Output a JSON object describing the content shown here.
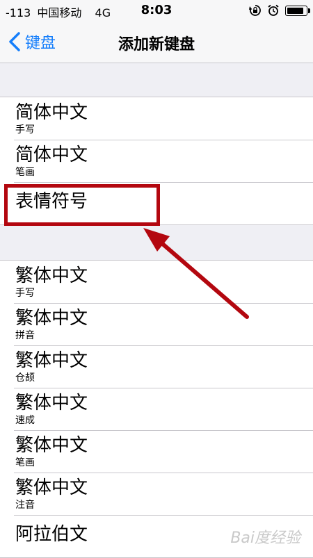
{
  "status_bar": {
    "signal": "-113",
    "carrier": "中国移动",
    "network": "4G",
    "time": "8:03"
  },
  "nav": {
    "back_label": "键盘",
    "title": "添加新键盘"
  },
  "groups": [
    {
      "rows": [
        {
          "title": "简体中文",
          "subtitle": "手写"
        },
        {
          "title": "简体中文",
          "subtitle": "笔画"
        },
        {
          "title": "表情符号",
          "subtitle": ""
        }
      ]
    },
    {
      "rows": [
        {
          "title": "繁体中文",
          "subtitle": "手写"
        },
        {
          "title": "繁体中文",
          "subtitle": "拼音"
        },
        {
          "title": "繁体中文",
          "subtitle": "仓颉"
        },
        {
          "title": "繁体中文",
          "subtitle": "速成"
        },
        {
          "title": "繁体中文",
          "subtitle": "笔画"
        },
        {
          "title": "繁体中文",
          "subtitle": "注音"
        },
        {
          "title": "阿拉伯文",
          "subtitle": ""
        }
      ]
    }
  ],
  "watermark": "Bai度经验",
  "colors": {
    "accent": "#157efb",
    "annotation": "#b3070f"
  },
  "icons": [
    "rotation-lock-icon",
    "alarm-icon",
    "battery-icon",
    "chevron-left-icon"
  ]
}
